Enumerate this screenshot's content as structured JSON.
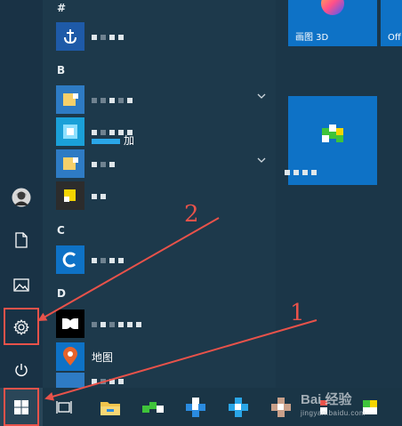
{
  "rail": {
    "items": [
      "avatar",
      "documents",
      "pictures",
      "settings",
      "power"
    ]
  },
  "sections": [
    {
      "letter": "#"
    },
    {
      "letter": "B"
    },
    {
      "letter": "C"
    },
    {
      "letter": "D"
    }
  ],
  "apps": {
    "partial_label": "加",
    "maps_label": "地图"
  },
  "tiles": {
    "paint3d_label": "画图 3D",
    "office_label": "Off"
  },
  "annotations": {
    "step1": "1",
    "step2": "2"
  },
  "watermark": {
    "main": "Bai 经验",
    "sub": "jingyan.baidu.com"
  },
  "colors": {
    "accent": "#0e72c6",
    "highlight": "#e8524a"
  }
}
